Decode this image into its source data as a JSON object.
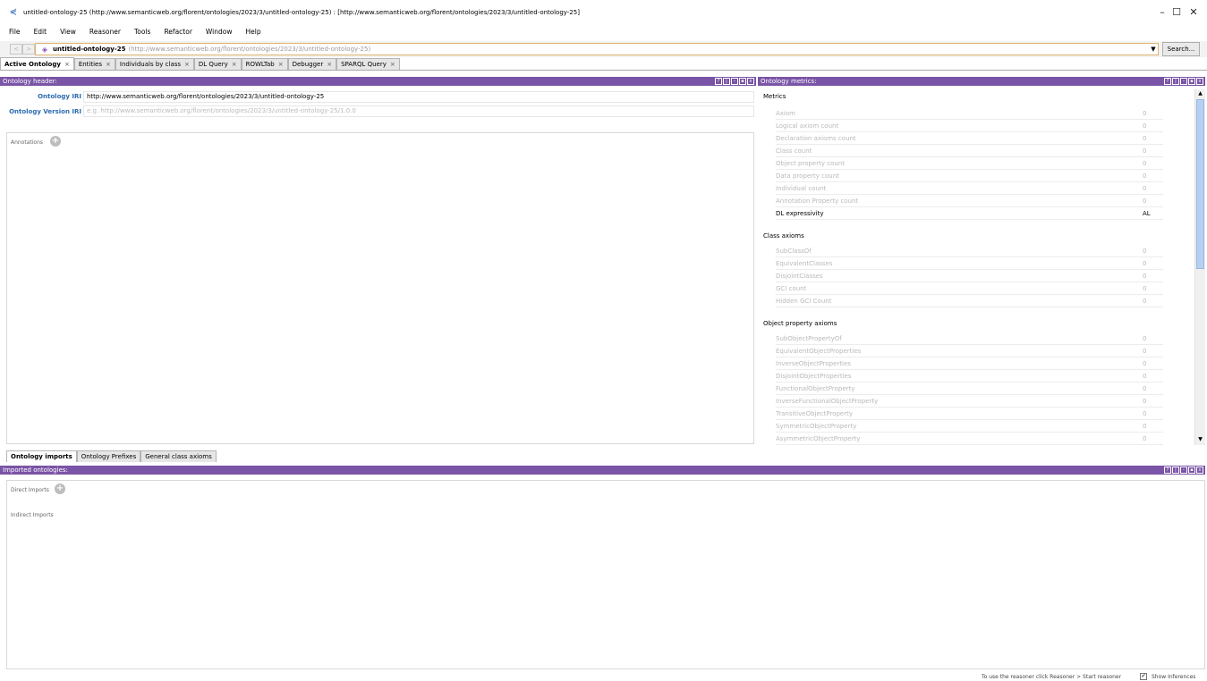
{
  "window": {
    "title": "untitled-ontology-25 (http://www.semanticweb.org/florent/ontologies/2023/3/untitled-ontology-25)  : [http://www.semanticweb.org/florent/ontologies/2023/3/untitled-ontology-25]",
    "minimize": "–",
    "maximize": "☐",
    "close": "✕"
  },
  "menu": [
    "File",
    "Edit",
    "View",
    "Reasoner",
    "Tools",
    "Refactor",
    "Window",
    "Help"
  ],
  "address": {
    "name": "untitled-ontology-25",
    "iri": "(http://www.semanticweb.org/florent/ontologies/2023/3/untitled-ontology-25)",
    "search_label": "Search..."
  },
  "tabs": [
    {
      "label": "Active Ontology",
      "active": true
    },
    {
      "label": "Entities",
      "active": false
    },
    {
      "label": "Individuals by class",
      "active": false
    },
    {
      "label": "DL Query",
      "active": false
    },
    {
      "label": "ROWLTab",
      "active": false
    },
    {
      "label": "Debugger",
      "active": false
    },
    {
      "label": "SPARQL Query",
      "active": false
    }
  ],
  "tab_close": "×",
  "header_panel": {
    "title": "Ontology header:",
    "iri_label": "Ontology IRI",
    "iri_value": "http://www.semanticweb.org/florent/ontologies/2023/3/untitled-ontology-25",
    "version_label": "Ontology Version IRI",
    "version_placeholder": "e.g. http://www.semanticweb.org/florent/ontologies/2023/3/untitled-ontology-25/1.0.0",
    "annotations_label": "Annotations"
  },
  "metrics_panel": {
    "title": "Ontology metrics:",
    "sections": [
      {
        "title": "Metrics",
        "rows": [
          {
            "name": "Axiom",
            "value": "0"
          },
          {
            "name": "Logical axiom count",
            "value": "0"
          },
          {
            "name": "Declaration axioms count",
            "value": "0"
          },
          {
            "name": "Class count",
            "value": "0"
          },
          {
            "name": "Object property count",
            "value": "0"
          },
          {
            "name": "Data property count",
            "value": "0"
          },
          {
            "name": "Individual count",
            "value": "0"
          },
          {
            "name": "Annotation Property count",
            "value": "0"
          },
          {
            "name": "DL expressivity",
            "value": "AL"
          }
        ]
      },
      {
        "title": "Class axioms",
        "rows": [
          {
            "name": "SubClassOf",
            "value": "0"
          },
          {
            "name": "EquivalentClasses",
            "value": "0"
          },
          {
            "name": "DisjointClasses",
            "value": "0"
          },
          {
            "name": "GCI count",
            "value": "0"
          },
          {
            "name": "Hidden GCI Count",
            "value": "0"
          }
        ]
      },
      {
        "title": "Object property axioms",
        "rows": [
          {
            "name": "SubObjectPropertyOf",
            "value": "0"
          },
          {
            "name": "EquivalentObjectProperties",
            "value": "0"
          },
          {
            "name": "InverseObjectProperties",
            "value": "0"
          },
          {
            "name": "DisjointObjectProperties",
            "value": "0"
          },
          {
            "name": "FunctionalObjectProperty",
            "value": "0"
          },
          {
            "name": "InverseFunctionalObjectProperty",
            "value": "0"
          },
          {
            "name": "TransitiveObjectProperty",
            "value": "0"
          },
          {
            "name": "SymmetricObjectProperty",
            "value": "0"
          },
          {
            "name": "AsymmetricObjectProperty",
            "value": "0"
          }
        ]
      }
    ]
  },
  "bottom_tabs": [
    {
      "label": "Ontology imports",
      "active": true
    },
    {
      "label": "Ontology Prefixes",
      "active": false
    },
    {
      "label": "General class axioms",
      "active": false
    }
  ],
  "imports_panel": {
    "title": "Imported ontologies:",
    "direct_label": "Direct Imports",
    "indirect_label": "Indirect Imports"
  },
  "status": {
    "message": "To use the reasoner click Reasoner > Start reasoner",
    "show_inferences_label": "Show Inferences",
    "show_inferences_checked": true
  },
  "colors": {
    "panel_header": "#7a54a6",
    "iri_label": "#2b6cb0",
    "address_border": "#e0b46b"
  },
  "icons": {
    "panel_controls": [
      "help-icon",
      "split-icon",
      "minimize-icon",
      "maximize-icon",
      "close-icon"
    ]
  }
}
